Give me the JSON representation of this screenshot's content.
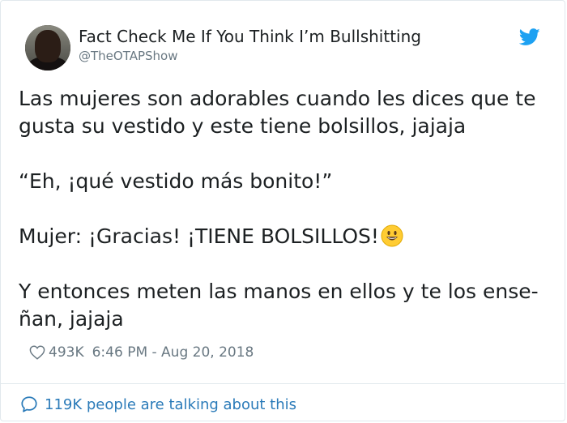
{
  "tweet": {
    "author": {
      "display_name": "Fact Check Me If You Think I’m Bullshitting",
      "handle": "@TheOTAPShow",
      "avatar_icon": "user-avatar"
    },
    "brand_icon": "twitter-bird-icon",
    "brand_color": "#1da1f2",
    "text": {
      "paragraph_1": "Las mujeres son adorables cuando les dices que te gusta su vestido y este tiene bolsillos, jajaja",
      "paragraph_2": "“Eh, ¡qué vestido más bonito!”",
      "paragraph_3": "Mujer: ¡Gracias! ¡TIENE BOLSILLOS!",
      "paragraph_3_emoji": "smiley-emoji",
      "paragraph_4": "Y entonces meten las manos en ellos y te los ense-ñan, jajaja"
    },
    "likes": "493K",
    "timestamp": "6:46 PM - Aug 20, 2018",
    "footer_link": "119K people are talking about this",
    "link_color": "#2b7bb9"
  }
}
